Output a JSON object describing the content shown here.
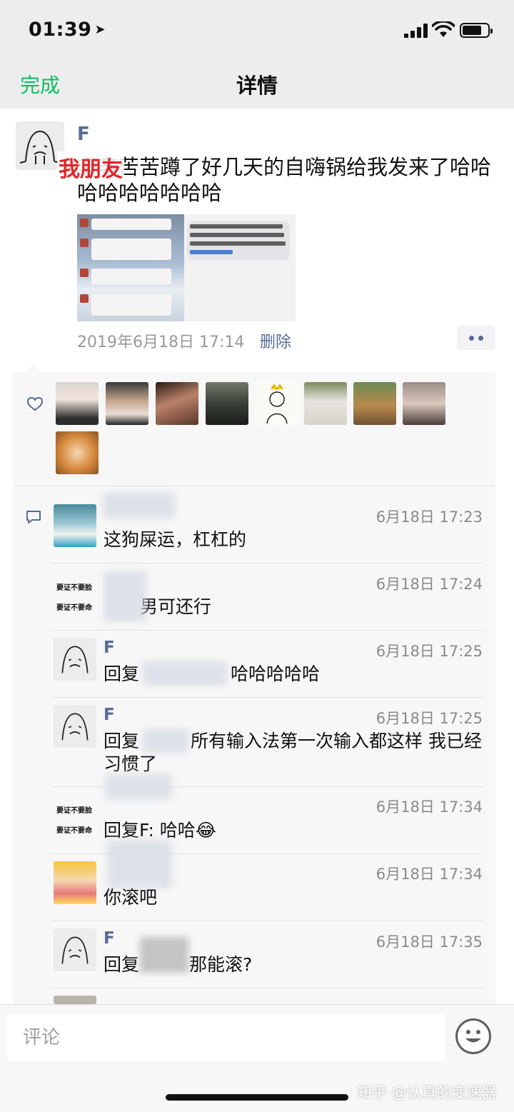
{
  "status_bar": {
    "time": "01:39"
  },
  "nav": {
    "done_label": "完成",
    "title": "详情"
  },
  "post": {
    "author": "F",
    "overlay_caption": "我朋友",
    "text": "辛辛苦苦蹲了好几天的自嗨锅给我发来了哈哈哈哈哈哈哈哈哈",
    "date": "2019年6月18日 17:14",
    "delete_label": "删除",
    "screenshot_text": {
      "sms_line1": "锅旗舰店】报告长官! 您购",
      "sms_line2": "贝已乘坐宅急送已发出, 运",
      "sms_line3": "000840686641, 请长官查阅",
      "sms_link": "b1.cn/BFJPGY"
    }
  },
  "likes": {
    "count": 10
  },
  "comments": [
    {
      "name": "",
      "time": "6月18日 17:23",
      "text": "这狗屎运，杠杠的",
      "avatar": "pool-photo"
    },
    {
      "name": "",
      "time": "6月18日 17:24",
      "text": "男可还行",
      "avatar": "text-avatar"
    },
    {
      "name": "F",
      "time": "6月18日 17:25",
      "text": "回复",
      "text_tail": "哈哈哈哈哈",
      "avatar": "ghost"
    },
    {
      "name": "F",
      "time": "6月18日 17:25",
      "text": "回复",
      "text_tail": "所有输入法第一次输入都这样 我已经习惯了",
      "avatar": "ghost"
    },
    {
      "name": "",
      "time": "6月18日 17:34",
      "text": "回复F: 哈哈😂",
      "avatar": "text-avatar"
    },
    {
      "name": "",
      "time": "6月18日 17:34",
      "text": "你滚吧",
      "avatar": "cartoon-girl"
    },
    {
      "name": "F",
      "time": "6月18日 17:35",
      "text": "回复",
      "text_tail": "那能滚?",
      "avatar": "ghost"
    }
  ],
  "text_avatar_lines": [
    "要证不要脸",
    "要证不要命"
  ],
  "bottom": {
    "comment_placeholder": "评论"
  },
  "watermark": "知乎 @认真的变速器",
  "colors": {
    "accent_green": "#07c160",
    "link_blue": "#576b95",
    "like_red": "#e0262b"
  }
}
